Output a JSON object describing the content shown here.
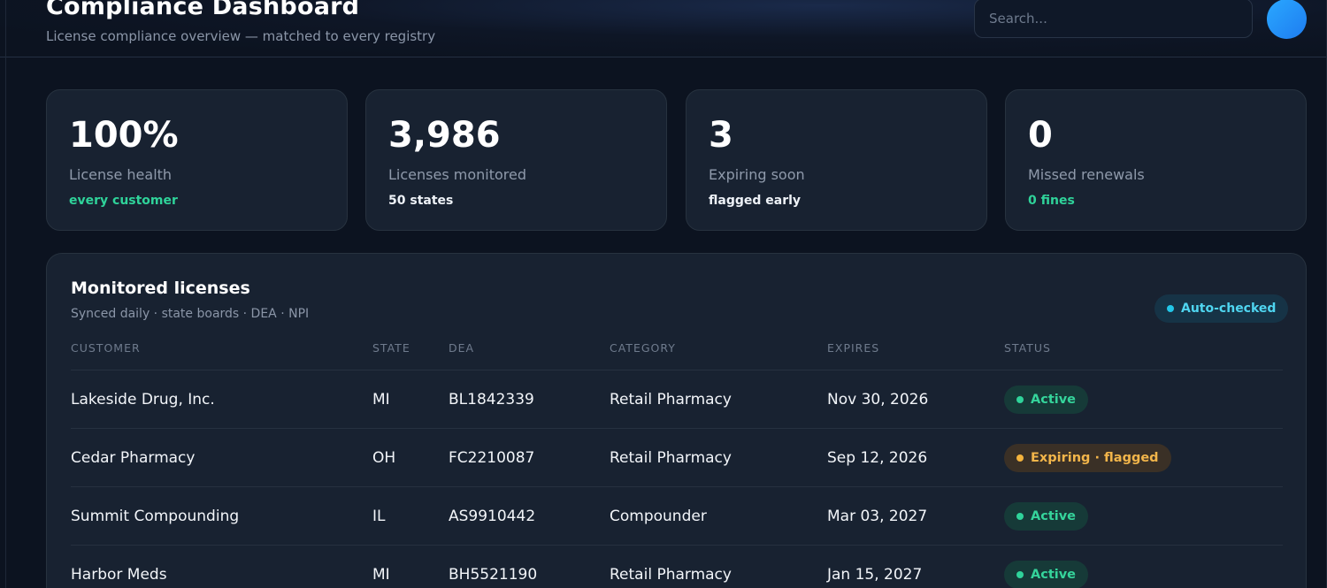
{
  "header": {
    "title": "Compliance Dashboard",
    "subtitle": "License compliance overview — matched to every registry",
    "search_placeholder": "Search..."
  },
  "stats": [
    {
      "value": "100%",
      "label": "License health",
      "note": "every customer",
      "note_color": "#2fd39a"
    },
    {
      "value": "3,986",
      "label": "Licenses monitored",
      "note": "50 states",
      "note_color": "#eef2f7"
    },
    {
      "value": "3",
      "label": "Expiring soon",
      "note": "flagged early",
      "note_color": "#eef2f7"
    },
    {
      "value": "0",
      "label": "Missed renewals",
      "note": "0 fines",
      "note_color": "#2fd39a"
    }
  ],
  "licenses_panel": {
    "title": "Monitored licenses",
    "subtitle": "Synced daily · state boards · DEA · NPI",
    "auto_badge": "Auto-checked",
    "columns": [
      "CUSTOMER",
      "STATE",
      "DEA",
      "CATEGORY",
      "EXPIRES",
      "STATUS"
    ],
    "rows": [
      {
        "customer": "Lakeside Drug, Inc.",
        "state": "MI",
        "dea": "BL1842339",
        "category": "Retail Pharmacy",
        "expires": "Nov 30, 2026",
        "status": "Active",
        "status_type": "active"
      },
      {
        "customer": "Cedar Pharmacy",
        "state": "OH",
        "dea": "FC2210087",
        "category": "Retail Pharmacy",
        "expires": "Sep 12, 2026",
        "status": "Expiring · flagged",
        "status_type": "expiring"
      },
      {
        "customer": "Summit Compounding",
        "state": "IL",
        "dea": "AS9910442",
        "category": "Compounder",
        "expires": "Mar 03, 2027",
        "status": "Active",
        "status_type": "active"
      },
      {
        "customer": "Harbor Meds",
        "state": "MI",
        "dea": "BH5521190",
        "category": "Retail Pharmacy",
        "expires": "Jan 15, 2027",
        "status": "Active",
        "status_type": "active"
      }
    ]
  },
  "colors": {
    "accent_green": "#2fd39a",
    "accent_cyan": "#22c6e8",
    "warning_amber": "#f4b33c",
    "background": "#0c1320",
    "card": "#182231"
  }
}
